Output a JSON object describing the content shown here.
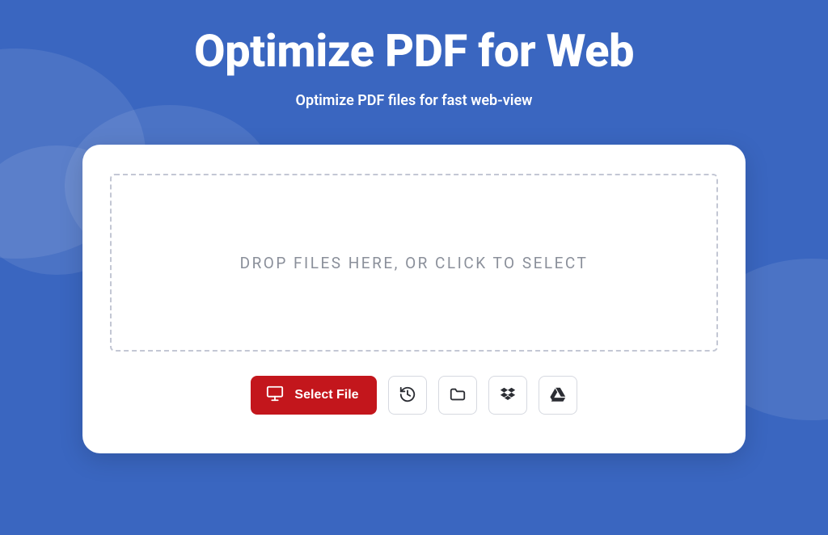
{
  "header": {
    "title": "Optimize PDF for Web",
    "subtitle": "Optimize PDF files for fast web-view"
  },
  "dropzone": {
    "text": "DROP FILES HERE, OR CLICK TO SELECT"
  },
  "actions": {
    "select_file_label": "Select File"
  },
  "colors": {
    "background": "#3a66c0",
    "primary_button": "#c3161c",
    "card": "#ffffff"
  }
}
